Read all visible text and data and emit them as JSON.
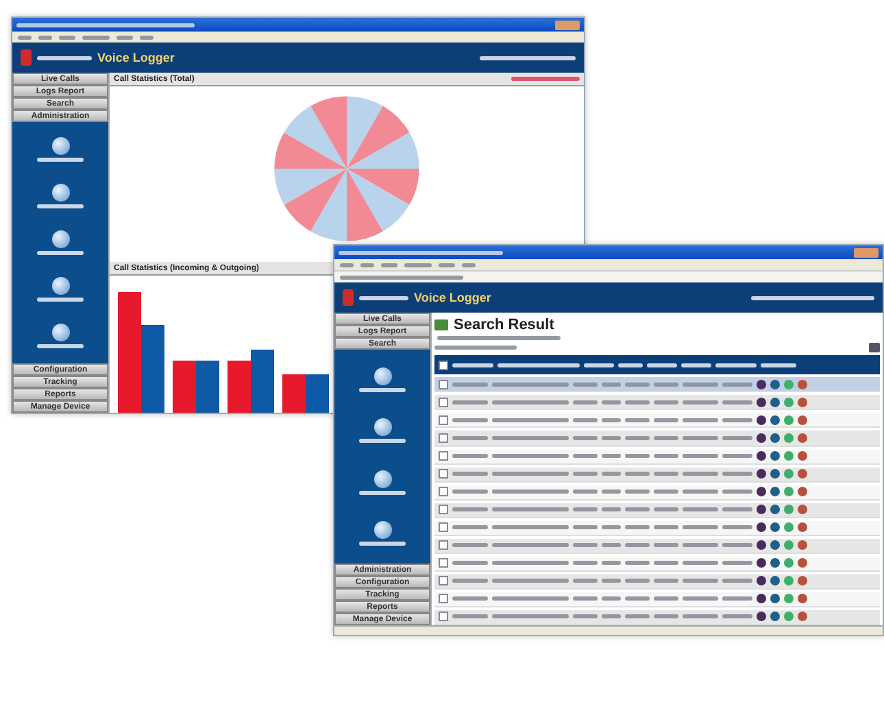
{
  "statistics_window": {
    "logo": "Voice Logger",
    "nav_top": [
      "Live Calls",
      "Logs Report",
      "Search",
      "Administration"
    ],
    "nav_bottom": [
      "Configuration",
      "Tracking",
      "Reports",
      "Manage Device"
    ],
    "pie_title": "Call Statistics (Total)",
    "bar_title": "Call Statistics (Incoming & Outgoing)"
  },
  "search_window": {
    "logo": "Voice Logger",
    "nav_top": [
      "Live Calls",
      "Logs Report",
      "Search"
    ],
    "nav_bottom": [
      "Administration",
      "Configuration",
      "Tracking",
      "Reports",
      "Manage Device"
    ],
    "title": "Search Result",
    "select_all": {
      "checked": false
    },
    "rows": [
      {
        "selected": true
      },
      {
        "selected": false
      },
      {
        "selected": false
      },
      {
        "selected": false
      },
      {
        "selected": false
      },
      {
        "selected": false
      },
      {
        "selected": false
      },
      {
        "selected": false
      },
      {
        "selected": false
      },
      {
        "selected": false
      },
      {
        "selected": false
      },
      {
        "selected": false
      },
      {
        "selected": false
      },
      {
        "selected": false
      }
    ]
  }
}
